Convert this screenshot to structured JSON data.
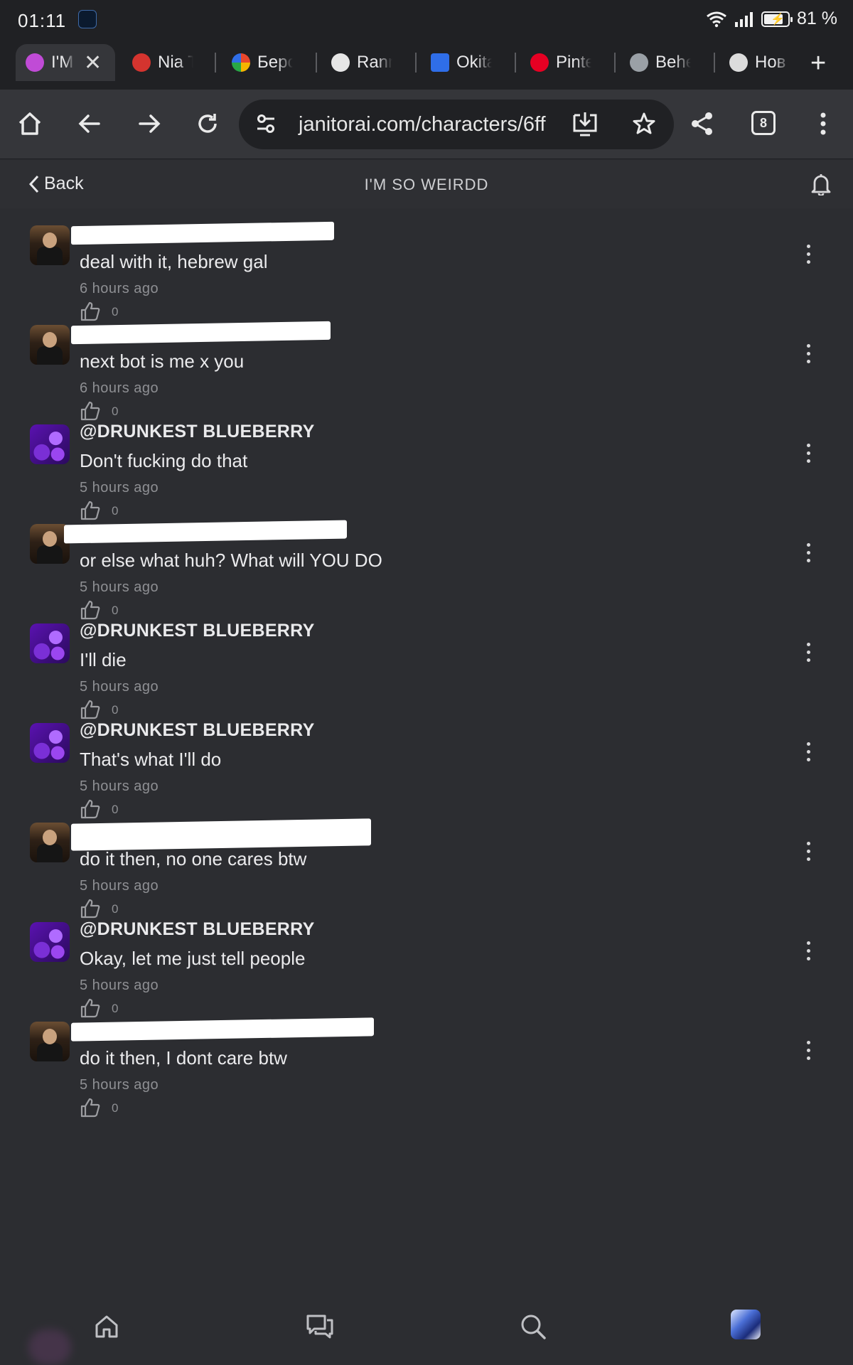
{
  "status_bar": {
    "time": "01:11",
    "battery": "81 %",
    "battery_level": 0.81
  },
  "tabs": [
    {
      "label": "I'M",
      "icon": "spiral-pink-favicon",
      "color": "#c04bd6"
    },
    {
      "label": "Nia T",
      "icon": "red-demon-favicon",
      "color": "#d4342f"
    },
    {
      "label": "Берс",
      "icon": "colorful-aperture-favicon",
      "color": "#e9472c"
    },
    {
      "label": "Ranm",
      "icon": "white-mask-favicon",
      "color": "#e6e6e6"
    },
    {
      "label": "Okita",
      "icon": "blue-t-favicon",
      "color": "#2f6ee8"
    },
    {
      "label": "Pinte",
      "icon": "pinterest-favicon",
      "color": "#e60023"
    },
    {
      "label": "Behe",
      "icon": "dragon-favicon",
      "color": "#9aa0a6"
    },
    {
      "label": "Нов",
      "icon": "chrome-favicon",
      "color": "#dcdcdc"
    }
  ],
  "browser": {
    "url": "janitorai.com/characters/6ff",
    "tab_count": "8"
  },
  "header": {
    "back_label": "Back",
    "title": "I'M SO WEIRDD"
  },
  "comments": [
    {
      "author": "",
      "avatar": "man",
      "text": "deal with it, hebrew gal",
      "time": "6 hours ago",
      "likes": "0"
    },
    {
      "author": "",
      "avatar": "man",
      "text": "next bot is me x you",
      "time": "6 hours ago",
      "likes": "0"
    },
    {
      "author": "@DRUNKEST BLUEBERRY",
      "avatar": "berry",
      "text": "Don't fucking do that",
      "time": "5 hours ago",
      "likes": "0"
    },
    {
      "author": "",
      "avatar": "man",
      "text": "or else what huh? What will YOU DO",
      "time": "5 hours ago",
      "likes": "0"
    },
    {
      "author": "@DRUNKEST BLUEBERRY",
      "avatar": "berry",
      "text": "I'll die",
      "time": "5 hours ago",
      "likes": "0"
    },
    {
      "author": "@DRUNKEST BLUEBERRY",
      "avatar": "berry",
      "text": "That's what I'll do",
      "time": "5 hours ago",
      "likes": "0"
    },
    {
      "author": "",
      "avatar": "man",
      "text": "do it then, no one cares btw",
      "time": "5 hours ago",
      "likes": "0"
    },
    {
      "author": "@DRUNKEST BLUEBERRY",
      "avatar": "berry",
      "text": "Okay, let me just tell people",
      "time": "5 hours ago",
      "likes": "0"
    },
    {
      "author": "",
      "avatar": "man",
      "text": "do it then, I dont care btw",
      "time": "5 hours ago",
      "likes": "0"
    }
  ],
  "bottom_nav": [
    {
      "name": "home-icon"
    },
    {
      "name": "chat-icon"
    },
    {
      "name": "search-icon"
    },
    {
      "name": "profile-avatar"
    }
  ]
}
